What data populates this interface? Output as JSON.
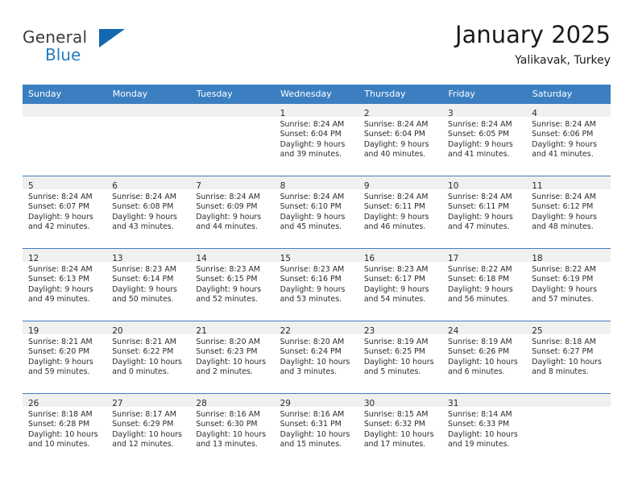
{
  "logo": {
    "word_top": "General",
    "word_bottom": "Blue",
    "triangle_color": "#1269b0",
    "blue_color": "#1f7ec4"
  },
  "header": {
    "title": "January 2025",
    "subtitle": "Yalikavak, Turkey"
  },
  "theme": {
    "header_bg": "#3c7fc1",
    "daynum_bg": "#f0f0f0",
    "grid_line": "#3c7fc1"
  },
  "weekday_headers": [
    "Sunday",
    "Monday",
    "Tuesday",
    "Wednesday",
    "Thursday",
    "Friday",
    "Saturday"
  ],
  "weeks": [
    [
      {
        "day": "",
        "lines": []
      },
      {
        "day": "",
        "lines": []
      },
      {
        "day": "",
        "lines": []
      },
      {
        "day": "1",
        "lines": [
          "Sunrise: 8:24 AM",
          "Sunset: 6:04 PM",
          "Daylight: 9 hours",
          "and 39 minutes."
        ]
      },
      {
        "day": "2",
        "lines": [
          "Sunrise: 8:24 AM",
          "Sunset: 6:04 PM",
          "Daylight: 9 hours",
          "and 40 minutes."
        ]
      },
      {
        "day": "3",
        "lines": [
          "Sunrise: 8:24 AM",
          "Sunset: 6:05 PM",
          "Daylight: 9 hours",
          "and 41 minutes."
        ]
      },
      {
        "day": "4",
        "lines": [
          "Sunrise: 8:24 AM",
          "Sunset: 6:06 PM",
          "Daylight: 9 hours",
          "and 41 minutes."
        ]
      }
    ],
    [
      {
        "day": "5",
        "lines": [
          "Sunrise: 8:24 AM",
          "Sunset: 6:07 PM",
          "Daylight: 9 hours",
          "and 42 minutes."
        ]
      },
      {
        "day": "6",
        "lines": [
          "Sunrise: 8:24 AM",
          "Sunset: 6:08 PM",
          "Daylight: 9 hours",
          "and 43 minutes."
        ]
      },
      {
        "day": "7",
        "lines": [
          "Sunrise: 8:24 AM",
          "Sunset: 6:09 PM",
          "Daylight: 9 hours",
          "and 44 minutes."
        ]
      },
      {
        "day": "8",
        "lines": [
          "Sunrise: 8:24 AM",
          "Sunset: 6:10 PM",
          "Daylight: 9 hours",
          "and 45 minutes."
        ]
      },
      {
        "day": "9",
        "lines": [
          "Sunrise: 8:24 AM",
          "Sunset: 6:11 PM",
          "Daylight: 9 hours",
          "and 46 minutes."
        ]
      },
      {
        "day": "10",
        "lines": [
          "Sunrise: 8:24 AM",
          "Sunset: 6:11 PM",
          "Daylight: 9 hours",
          "and 47 minutes."
        ]
      },
      {
        "day": "11",
        "lines": [
          "Sunrise: 8:24 AM",
          "Sunset: 6:12 PM",
          "Daylight: 9 hours",
          "and 48 minutes."
        ]
      }
    ],
    [
      {
        "day": "12",
        "lines": [
          "Sunrise: 8:24 AM",
          "Sunset: 6:13 PM",
          "Daylight: 9 hours",
          "and 49 minutes."
        ]
      },
      {
        "day": "13",
        "lines": [
          "Sunrise: 8:23 AM",
          "Sunset: 6:14 PM",
          "Daylight: 9 hours",
          "and 50 minutes."
        ]
      },
      {
        "day": "14",
        "lines": [
          "Sunrise: 8:23 AM",
          "Sunset: 6:15 PM",
          "Daylight: 9 hours",
          "and 52 minutes."
        ]
      },
      {
        "day": "15",
        "lines": [
          "Sunrise: 8:23 AM",
          "Sunset: 6:16 PM",
          "Daylight: 9 hours",
          "and 53 minutes."
        ]
      },
      {
        "day": "16",
        "lines": [
          "Sunrise: 8:23 AM",
          "Sunset: 6:17 PM",
          "Daylight: 9 hours",
          "and 54 minutes."
        ]
      },
      {
        "day": "17",
        "lines": [
          "Sunrise: 8:22 AM",
          "Sunset: 6:18 PM",
          "Daylight: 9 hours",
          "and 56 minutes."
        ]
      },
      {
        "day": "18",
        "lines": [
          "Sunrise: 8:22 AM",
          "Sunset: 6:19 PM",
          "Daylight: 9 hours",
          "and 57 minutes."
        ]
      }
    ],
    [
      {
        "day": "19",
        "lines": [
          "Sunrise: 8:21 AM",
          "Sunset: 6:20 PM",
          "Daylight: 9 hours",
          "and 59 minutes."
        ]
      },
      {
        "day": "20",
        "lines": [
          "Sunrise: 8:21 AM",
          "Sunset: 6:22 PM",
          "Daylight: 10 hours",
          "and 0 minutes."
        ]
      },
      {
        "day": "21",
        "lines": [
          "Sunrise: 8:20 AM",
          "Sunset: 6:23 PM",
          "Daylight: 10 hours",
          "and 2 minutes."
        ]
      },
      {
        "day": "22",
        "lines": [
          "Sunrise: 8:20 AM",
          "Sunset: 6:24 PM",
          "Daylight: 10 hours",
          "and 3 minutes."
        ]
      },
      {
        "day": "23",
        "lines": [
          "Sunrise: 8:19 AM",
          "Sunset: 6:25 PM",
          "Daylight: 10 hours",
          "and 5 minutes."
        ]
      },
      {
        "day": "24",
        "lines": [
          "Sunrise: 8:19 AM",
          "Sunset: 6:26 PM",
          "Daylight: 10 hours",
          "and 6 minutes."
        ]
      },
      {
        "day": "25",
        "lines": [
          "Sunrise: 8:18 AM",
          "Sunset: 6:27 PM",
          "Daylight: 10 hours",
          "and 8 minutes."
        ]
      }
    ],
    [
      {
        "day": "26",
        "lines": [
          "Sunrise: 8:18 AM",
          "Sunset: 6:28 PM",
          "Daylight: 10 hours",
          "and 10 minutes."
        ]
      },
      {
        "day": "27",
        "lines": [
          "Sunrise: 8:17 AM",
          "Sunset: 6:29 PM",
          "Daylight: 10 hours",
          "and 12 minutes."
        ]
      },
      {
        "day": "28",
        "lines": [
          "Sunrise: 8:16 AM",
          "Sunset: 6:30 PM",
          "Daylight: 10 hours",
          "and 13 minutes."
        ]
      },
      {
        "day": "29",
        "lines": [
          "Sunrise: 8:16 AM",
          "Sunset: 6:31 PM",
          "Daylight: 10 hours",
          "and 15 minutes."
        ]
      },
      {
        "day": "30",
        "lines": [
          "Sunrise: 8:15 AM",
          "Sunset: 6:32 PM",
          "Daylight: 10 hours",
          "and 17 minutes."
        ]
      },
      {
        "day": "31",
        "lines": [
          "Sunrise: 8:14 AM",
          "Sunset: 6:33 PM",
          "Daylight: 10 hours",
          "and 19 minutes."
        ]
      },
      {
        "day": "",
        "lines": []
      }
    ]
  ]
}
